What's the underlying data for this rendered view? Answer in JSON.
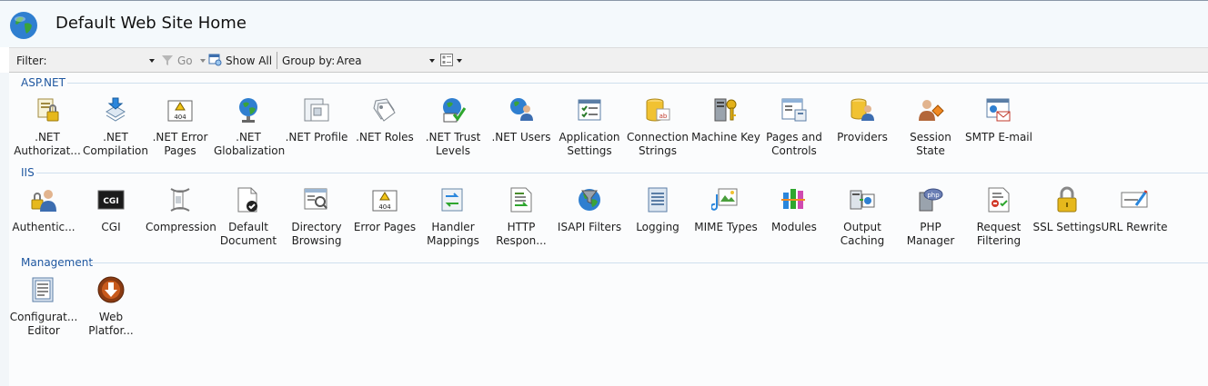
{
  "header": {
    "title": "Default Web Site Home"
  },
  "toolbar": {
    "filter_label": "Filter:",
    "go_label": "Go",
    "show_all_label": "Show All",
    "group_by_label": "Group by:",
    "group_by_value": "Area"
  },
  "sections": [
    {
      "title": "ASP.NET",
      "items": [
        {
          "label": ".NET\nAuthorizat...",
          "icon": "authorization-icon"
        },
        {
          "label": ".NET\nCompilation",
          "icon": "compilation-icon"
        },
        {
          "label": ".NET Error\nPages",
          "icon": "error-pages-icon"
        },
        {
          "label": ".NET\nGlobalization",
          "icon": "globalization-icon"
        },
        {
          "label": ".NET Profile",
          "icon": "profile-icon"
        },
        {
          "label": ".NET Roles",
          "icon": "roles-icon"
        },
        {
          "label": ".NET Trust\nLevels",
          "icon": "trust-levels-icon"
        },
        {
          "label": ".NET Users",
          "icon": "users-icon"
        },
        {
          "label": "Application\nSettings",
          "icon": "app-settings-icon"
        },
        {
          "label": "Connection\nStrings",
          "icon": "connection-strings-icon"
        },
        {
          "label": "Machine Key",
          "icon": "machine-key-icon"
        },
        {
          "label": "Pages and\nControls",
          "icon": "pages-controls-icon"
        },
        {
          "label": "Providers",
          "icon": "providers-icon"
        },
        {
          "label": "Session State",
          "icon": "session-state-icon"
        },
        {
          "label": "SMTP E-mail",
          "icon": "smtp-email-icon"
        }
      ]
    },
    {
      "title": "IIS",
      "items": [
        {
          "label": "Authentic...",
          "icon": "authentication-icon"
        },
        {
          "label": "CGI",
          "icon": "cgi-icon"
        },
        {
          "label": "Compression",
          "icon": "compression-icon"
        },
        {
          "label": "Default\nDocument",
          "icon": "default-document-icon"
        },
        {
          "label": "Directory\nBrowsing",
          "icon": "directory-browsing-icon"
        },
        {
          "label": "Error Pages",
          "icon": "error-pages-icon"
        },
        {
          "label": "Handler\nMappings",
          "icon": "handler-mappings-icon"
        },
        {
          "label": "HTTP\nRespon...",
          "icon": "http-response-icon"
        },
        {
          "label": "ISAPI Filters",
          "icon": "isapi-filters-icon"
        },
        {
          "label": "Logging",
          "icon": "logging-icon"
        },
        {
          "label": "MIME Types",
          "icon": "mime-types-icon"
        },
        {
          "label": "Modules",
          "icon": "modules-icon"
        },
        {
          "label": "Output\nCaching",
          "icon": "output-caching-icon"
        },
        {
          "label": "PHP\nManager",
          "icon": "php-manager-icon"
        },
        {
          "label": "Request\nFiltering",
          "icon": "request-filtering-icon"
        },
        {
          "label": "SSL Settings",
          "icon": "ssl-settings-icon"
        },
        {
          "label": "URL Rewrite",
          "icon": "url-rewrite-icon"
        }
      ]
    },
    {
      "title": "Management",
      "items": [
        {
          "label": "Configurat...\nEditor",
          "icon": "configuration-editor-icon"
        },
        {
          "label": "Web\nPlatfor...",
          "icon": "web-platform-icon"
        }
      ]
    }
  ]
}
